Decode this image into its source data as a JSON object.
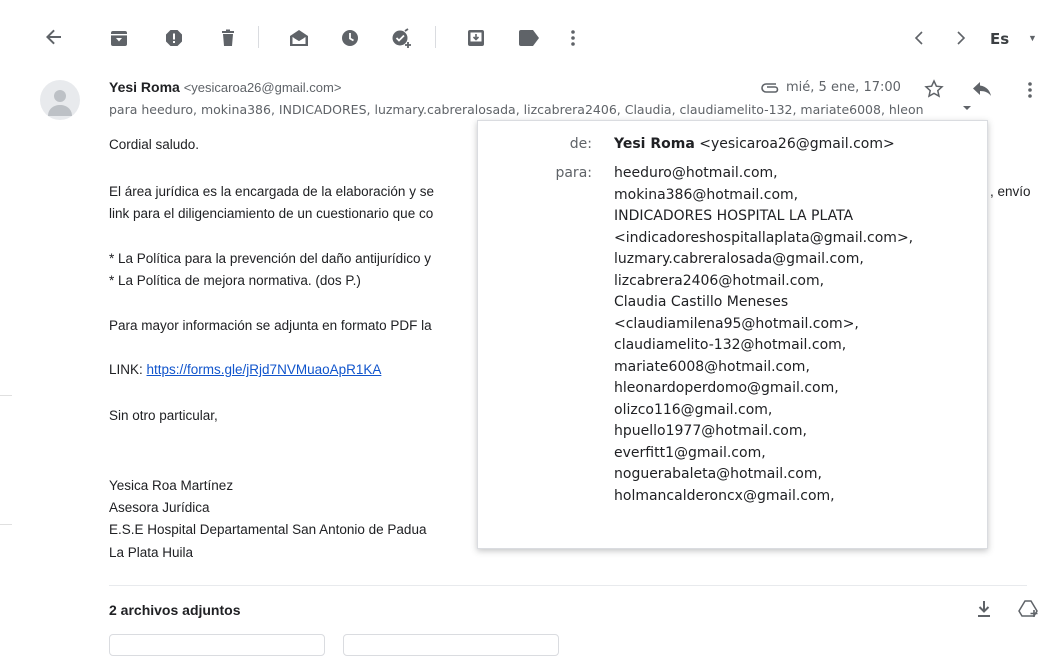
{
  "toolbar": {
    "icons": [
      "back-arrow-icon",
      "archive-icon",
      "report-spam-icon",
      "delete-icon",
      "mark-unread-icon",
      "snooze-icon",
      "add-to-tasks-icon",
      "move-to-icon",
      "labels-icon",
      "more-vert-icon",
      "newer-chevron-icon",
      "older-chevron-icon"
    ],
    "language": "Es"
  },
  "message": {
    "sender_name": "Yesi Roma",
    "sender_email": "<yesicaroa26@gmail.com>",
    "to_summary": "para heeduro, mokina386, INDICADORES, luzmary.cabreralosada, lizcabrera2406, Claudia, claudiamelito-132, mariate6008, hleon",
    "date": "mié, 5 ene, 17:00",
    "body": {
      "greeting": "Cordial saludo.",
      "p1_line1": "El área jurídica es la encargada de la elaboración y se",
      "p1_line1_tail": ", envío",
      "p1_line2": "link para el diligenciamiento de un cuestionario que co",
      "item1": "* La Política para la prevención del daño antijurídico y",
      "item2": "* La Política de mejora normativa. (dos P.)",
      "info": "Para mayor información se adjunta en formato PDF la",
      "link_label": "LINK: ",
      "link_url": "https://forms.gle/jRjd7NVMuaoApR1KA",
      "closing": "Sin otro particular,",
      "sig_name": "Yesica Roa Martínez",
      "sig_role": "Asesora Jurídica",
      "sig_org": "E.S.E Hospital Departamental San Antonio de Padua",
      "sig_city": "La Plata Huila"
    }
  },
  "details_popup": {
    "from_label": "de:",
    "from_name": "Yesi Roma",
    "from_email": "<yesicaroa26@gmail.com>",
    "to_label": "para:",
    "recipients": [
      "heeduro@hotmail.com,",
      "mokina386@hotmail.com,",
      "INDICADORES HOSPITAL LA PLATA",
      "<indicadoreshospitallaplata@gmail.com>,",
      "luzmary.cabreralosada@gmail.com,",
      "lizcabrera2406@hotmail.com,",
      "Claudia Castillo Meneses",
      "<claudiamilena95@hotmail.com>,",
      "claudiamelito-132@hotmail.com,",
      "mariate6008@hotmail.com,",
      "hleonardoperdomo@gmail.com,",
      "olizco116@gmail.com,",
      "hpuello1977@hotmail.com,",
      "everfitt1@gmail.com,",
      "noguerabaleta@hotmail.com,",
      "holmancalderoncx@gmail.com,"
    ]
  },
  "attachments": {
    "title": "2 archivos adjuntos"
  }
}
